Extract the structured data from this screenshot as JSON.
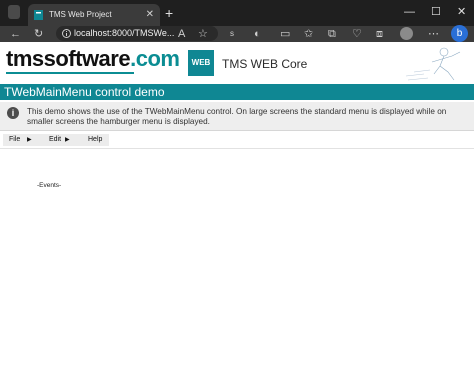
{
  "browser": {
    "tab_title": "TMS Web Project",
    "tab_close": "✕",
    "new_tab": "+",
    "window_controls": [
      "—",
      "☐",
      "✕"
    ],
    "url": "localhost:8000/TMSWe...",
    "nav_icons": [
      "back-icon",
      "refresh-icon",
      "info-icon"
    ],
    "toolbar_icons": [
      "read-aloud-icon",
      "favorite-icon",
      "extension-icon",
      "split-screen-icon",
      "favorites-icon",
      "collections-icon",
      "browser-essentials-icon",
      "profile-icon",
      "more-icon",
      "copilot-icon"
    ],
    "bing_label": "b"
  },
  "header": {
    "logo_text": "tmssoftware",
    "logo_suffix": ".com",
    "badge_text": "WEB",
    "product_title": "TMS WEB Core"
  },
  "banner": {
    "title": "TWebMainMenu control demo"
  },
  "info": {
    "icon": "i",
    "text": "This demo shows the use of the TWebMainMenu control. On large screens the standard menu is displayed while on smaller screens the hamburger menu is displayed."
  },
  "menu": {
    "items": [
      {
        "label": "File",
        "arrow": "▶"
      },
      {
        "label": "Edit",
        "arrow": "▶"
      },
      {
        "label": "Help",
        "arrow": ""
      }
    ]
  },
  "events_label": "-Events-",
  "colors": {
    "teal": "#0f8793",
    "chrome_dark": "#1f1f1f"
  }
}
